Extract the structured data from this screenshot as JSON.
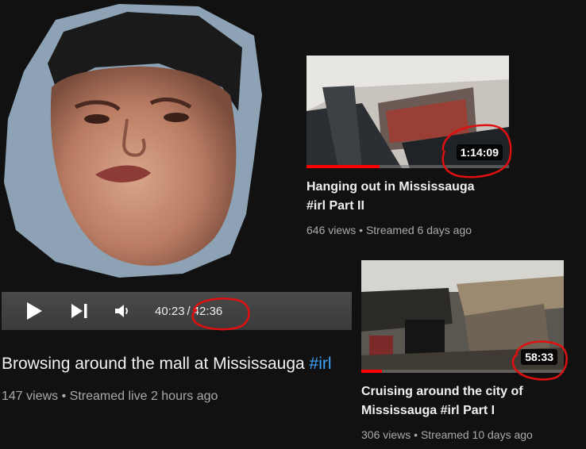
{
  "player": {
    "current_time": "40:23",
    "separator": "/",
    "total_time": "42:36"
  },
  "main_video": {
    "title": "Browsing around the mall at Mississauga",
    "hashtag": "#irl",
    "views": "147 views",
    "streamed": "Streamed live 2 hours ago"
  },
  "videos": [
    {
      "title_line1": "Hanging out in Mississauga",
      "title_line2": "#irl Part II",
      "duration": "1:14:09",
      "views": "646 views",
      "streamed": "Streamed 6 days ago",
      "watched_fraction": 0.36
    },
    {
      "title_line1": "Cruising around the city of",
      "title_line2": "Mississauga #irl Part I",
      "duration": "58:33",
      "views": "306 views",
      "streamed": "Streamed 10 days ago",
      "watched_fraction": 0.1
    }
  ],
  "meta_separator": "•",
  "colors": {
    "background": "#111111",
    "accent_red": "#ff0000",
    "annotation_red": "#e01010",
    "hashtag_blue": "#3ea6ff",
    "meta_gray": "#aaaaaa"
  },
  "icons": [
    "play-icon",
    "skip-next-icon",
    "volume-icon"
  ]
}
